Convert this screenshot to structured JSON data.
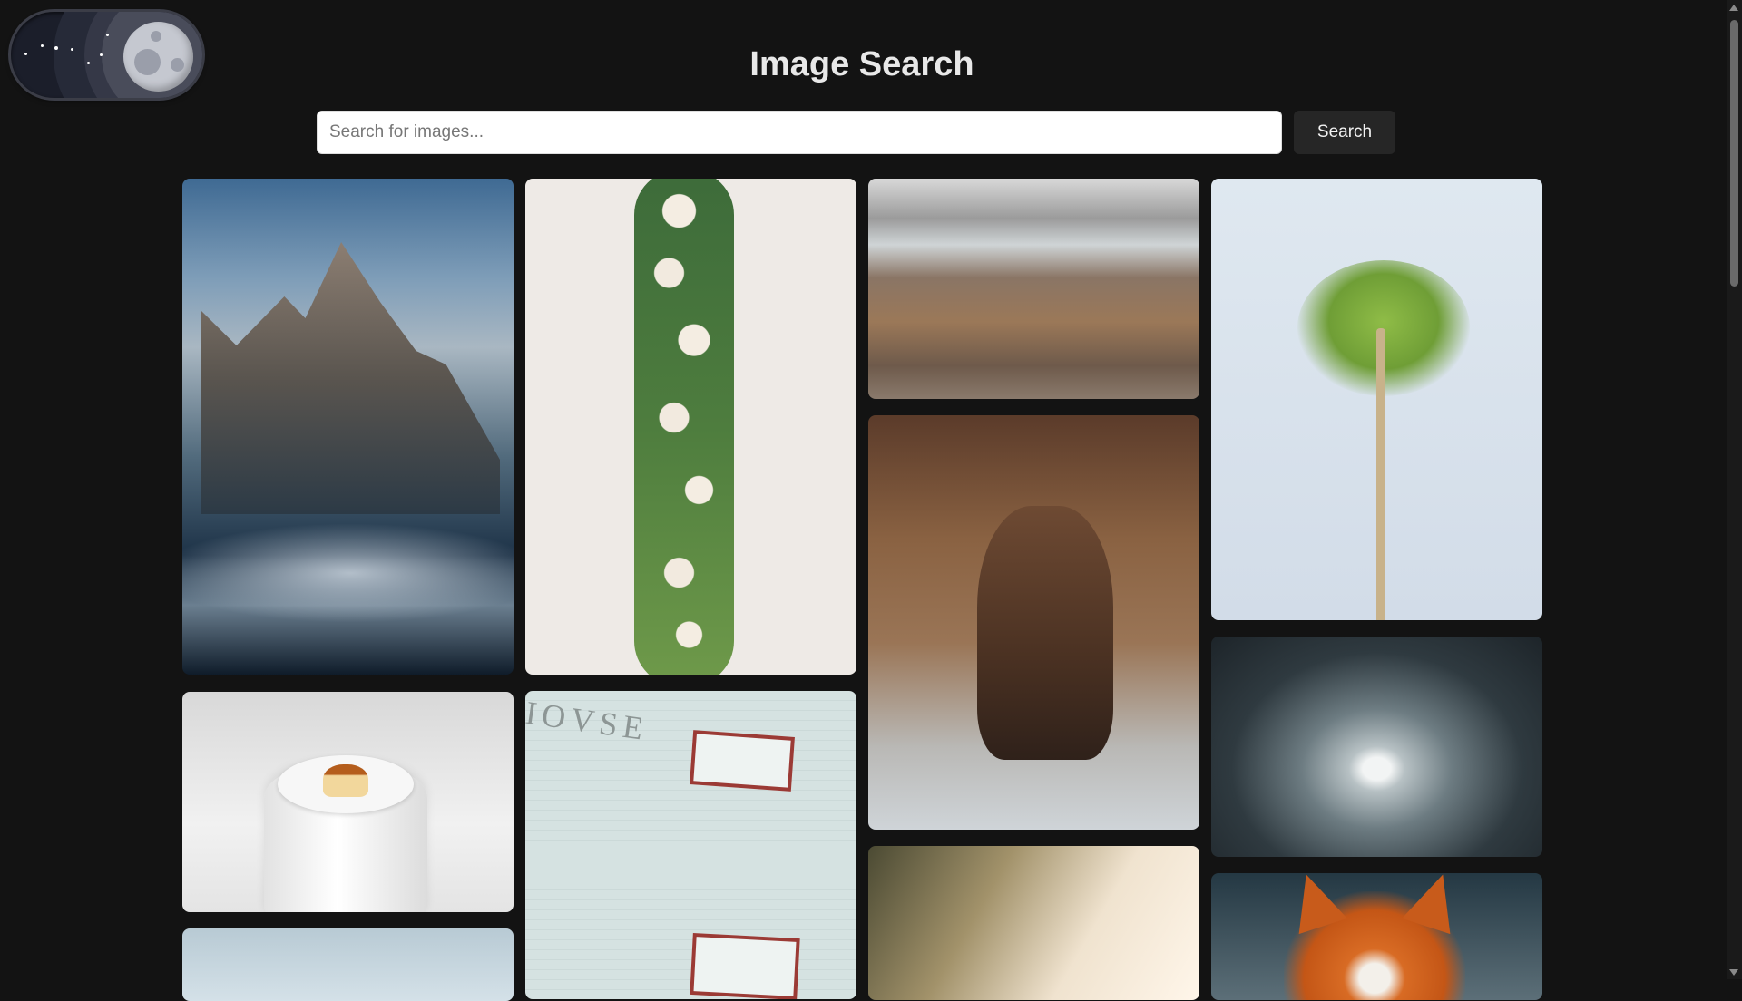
{
  "header": {
    "title": "Image Search"
  },
  "search": {
    "placeholder": "Search for images...",
    "value": "",
    "button_label": "Search"
  },
  "theme_toggle": {
    "mode": "dark",
    "icon": "moon-icon"
  },
  "gallery": {
    "images": [
      {
        "subject": "mountain-peak"
      },
      {
        "subject": "flower-garland"
      },
      {
        "subject": "snowy-hills"
      },
      {
        "subject": "palm-tree"
      },
      {
        "subject": "horse-riders"
      },
      {
        "subject": "tunnel"
      },
      {
        "subject": "pudding"
      },
      {
        "subject": "brick-building",
        "sign_text": "IOVSE"
      },
      {
        "subject": "sunlit-forest"
      },
      {
        "subject": "fox"
      },
      {
        "subject": "blue-building"
      }
    ]
  },
  "colors": {
    "background": "#131313",
    "title": "#e8e8e8",
    "button": "#262626"
  }
}
